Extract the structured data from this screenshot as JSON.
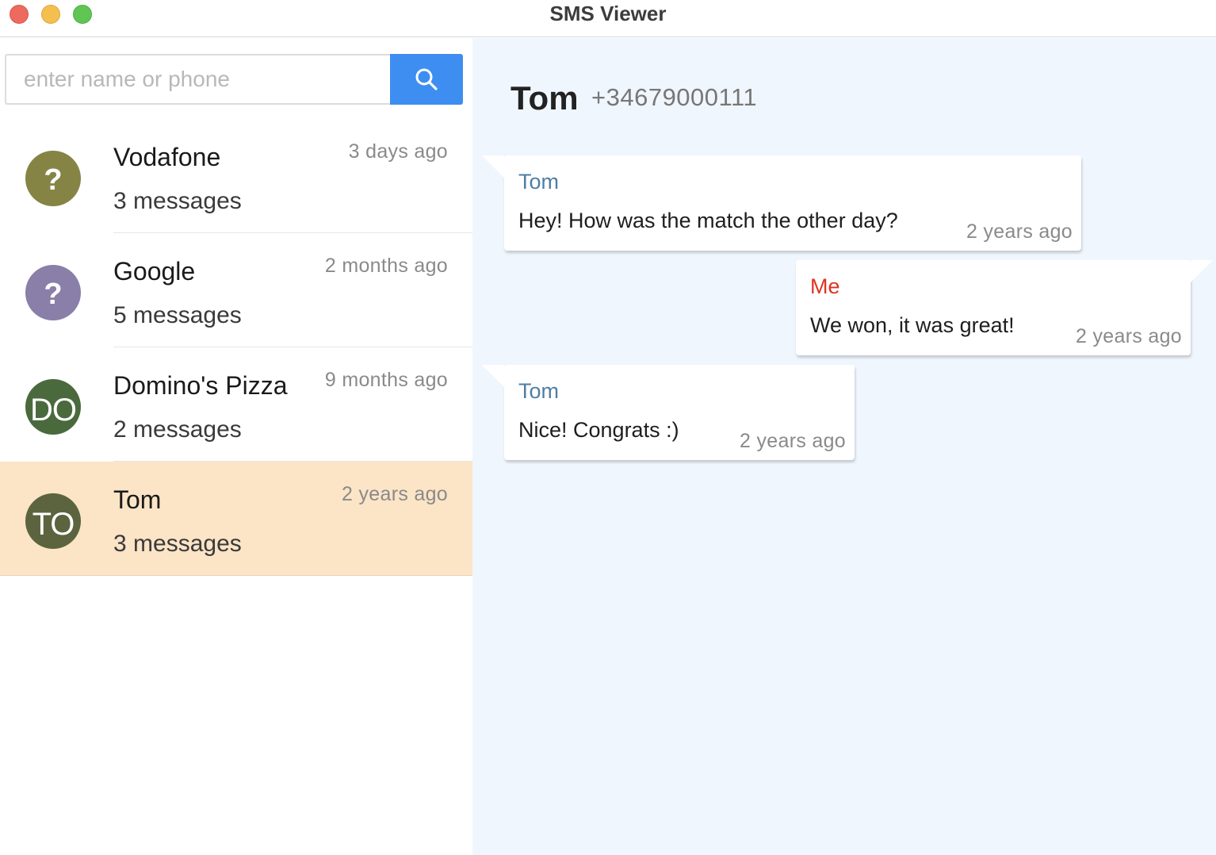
{
  "window": {
    "title": "SMS Viewer"
  },
  "search": {
    "placeholder": "enter name or phone",
    "value": ""
  },
  "contacts": [
    {
      "name": "Vodafone",
      "count": "3 messages",
      "time": "3 days ago",
      "avatar_text": "?",
      "avatar_color": "#868444",
      "selected": false
    },
    {
      "name": "Google",
      "count": "5 messages",
      "time": "2 months ago",
      "avatar_text": "?",
      "avatar_color": "#8a7fa9",
      "selected": false
    },
    {
      "name": "Domino's Pizza",
      "count": "2 messages",
      "time": "9 months ago",
      "avatar_text": "DO",
      "avatar_color": "#4a6a3e",
      "selected": false
    },
    {
      "name": "Tom",
      "count": "3 messages",
      "time": "2 years ago",
      "avatar_text": "TO",
      "avatar_color": "#5b643f",
      "selected": true
    }
  ],
  "conversation": {
    "name": "Tom",
    "phone": "+34679000111",
    "messages": [
      {
        "sender": "Tom",
        "direction": "in",
        "text": "Hey! How was the match the other day?",
        "time": "2 years ago"
      },
      {
        "sender": "Me",
        "direction": "out",
        "text": "We won, it was great!",
        "time": "2 years ago"
      },
      {
        "sender": "Tom",
        "direction": "in",
        "text": "Nice! Congrats :)",
        "time": "2 years ago"
      }
    ]
  },
  "colors": {
    "accent": "#3d8ef0",
    "selected_row": "#fce4c6",
    "panel_bg": "#f0f6fd",
    "sender_them": "#4f7ea2",
    "sender_me": "#e03221"
  },
  "icons": {
    "search_button": "search-icon"
  }
}
